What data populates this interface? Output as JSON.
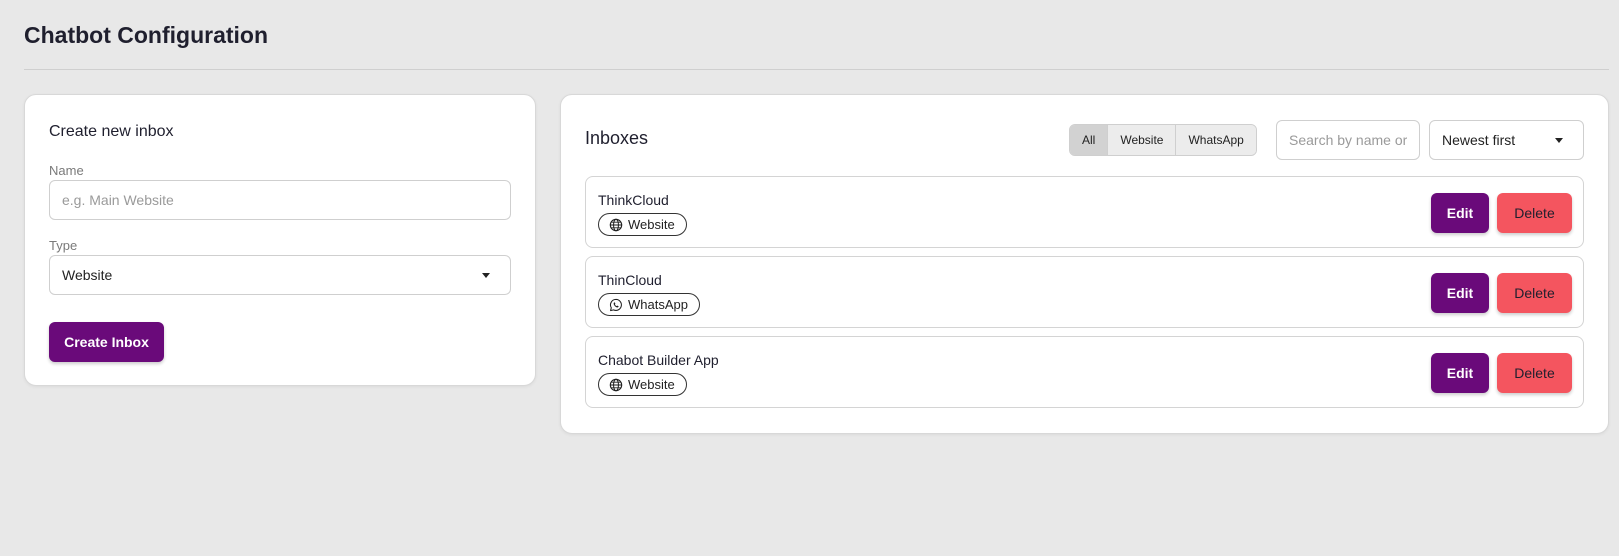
{
  "page": {
    "title": "Chatbot Configuration"
  },
  "create_form": {
    "heading": "Create new inbox",
    "name_label": "Name",
    "name_placeholder": "e.g. Main Website",
    "name_value": "",
    "type_label": "Type",
    "type_value": "Website",
    "submit_label": "Create Inbox"
  },
  "inboxes_panel": {
    "heading": "Inboxes",
    "filters": [
      {
        "label": "All",
        "active": true
      },
      {
        "label": "Website",
        "active": false
      },
      {
        "label": "WhatsApp",
        "active": false
      }
    ],
    "search_placeholder": "Search by name or",
    "sort_value": "Newest first",
    "edit_label": "Edit",
    "delete_label": "Delete",
    "items": [
      {
        "name": "ThinkCloud",
        "type": "Website",
        "icon": "globe-icon"
      },
      {
        "name": "ThinCloud",
        "type": "WhatsApp",
        "icon": "whatsapp-icon"
      },
      {
        "name": "Chabot Builder App",
        "type": "Website",
        "icon": "globe-icon"
      }
    ]
  },
  "colors": {
    "background": "#e8e8e8",
    "primary": "#6a0a7a",
    "danger": "#f4555f"
  }
}
